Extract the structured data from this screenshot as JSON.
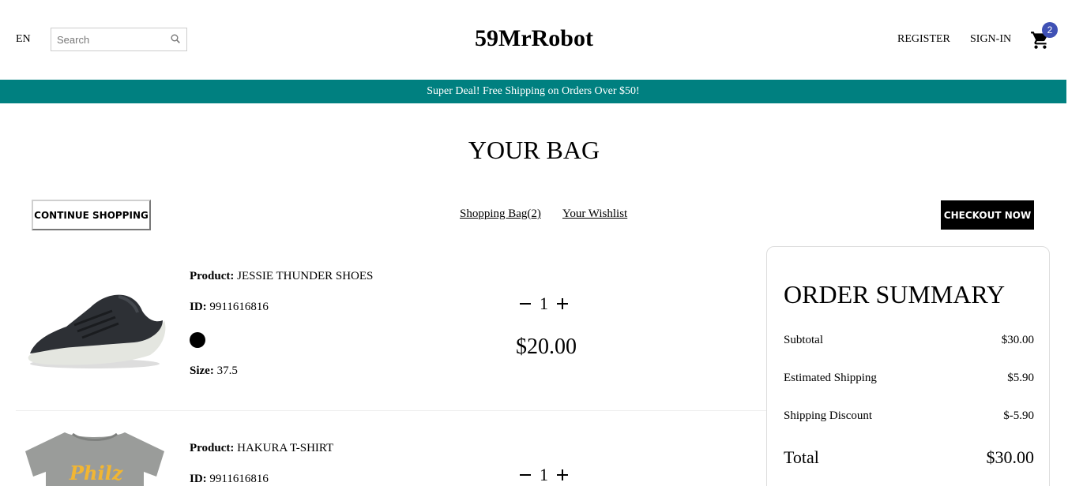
{
  "navbar": {
    "language": "EN",
    "search_placeholder": "Search",
    "logo": "59MrRobot",
    "register": "REGISTER",
    "signin": "SIGN-IN",
    "cart_count": "2"
  },
  "announcement": "Super Deal! Free Shipping on Orders Over $50!",
  "page_title": "YOUR BAG",
  "top": {
    "continue_label": "CONTINUE SHOPPING",
    "shopping_bag_label": "Shopping Bag(2)",
    "wishlist_label": "Your Wishlist",
    "checkout_label": "CHECKOUT NOW"
  },
  "labels": {
    "product": "Product:",
    "id": "ID:",
    "size": "Size:"
  },
  "products": [
    {
      "name": "JESSIE THUNDER SHOES",
      "id": "9911616816",
      "color": "#000000",
      "size": "37.5",
      "quantity": "1",
      "price": "$20.00",
      "image_icon": "shoe-image"
    },
    {
      "name": "HAKURA T-SHIRT",
      "id": "9911616816",
      "quantity": "1",
      "image_icon": "tshirt-image",
      "image_text": "Philz"
    }
  ],
  "summary": {
    "title": "ORDER SUMMARY",
    "subtotal_label": "Subtotal",
    "subtotal_value": "$30.00",
    "shipping_label": "Estimated Shipping",
    "shipping_value": "$5.90",
    "discount_label": "Shipping Discount",
    "discount_value": "$-5.90",
    "total_label": "Total",
    "total_value": "$30.00"
  },
  "colors": {
    "announcement_bg": "#008080",
    "badge_bg": "#3f51b5",
    "checkout_bg": "#000000"
  }
}
